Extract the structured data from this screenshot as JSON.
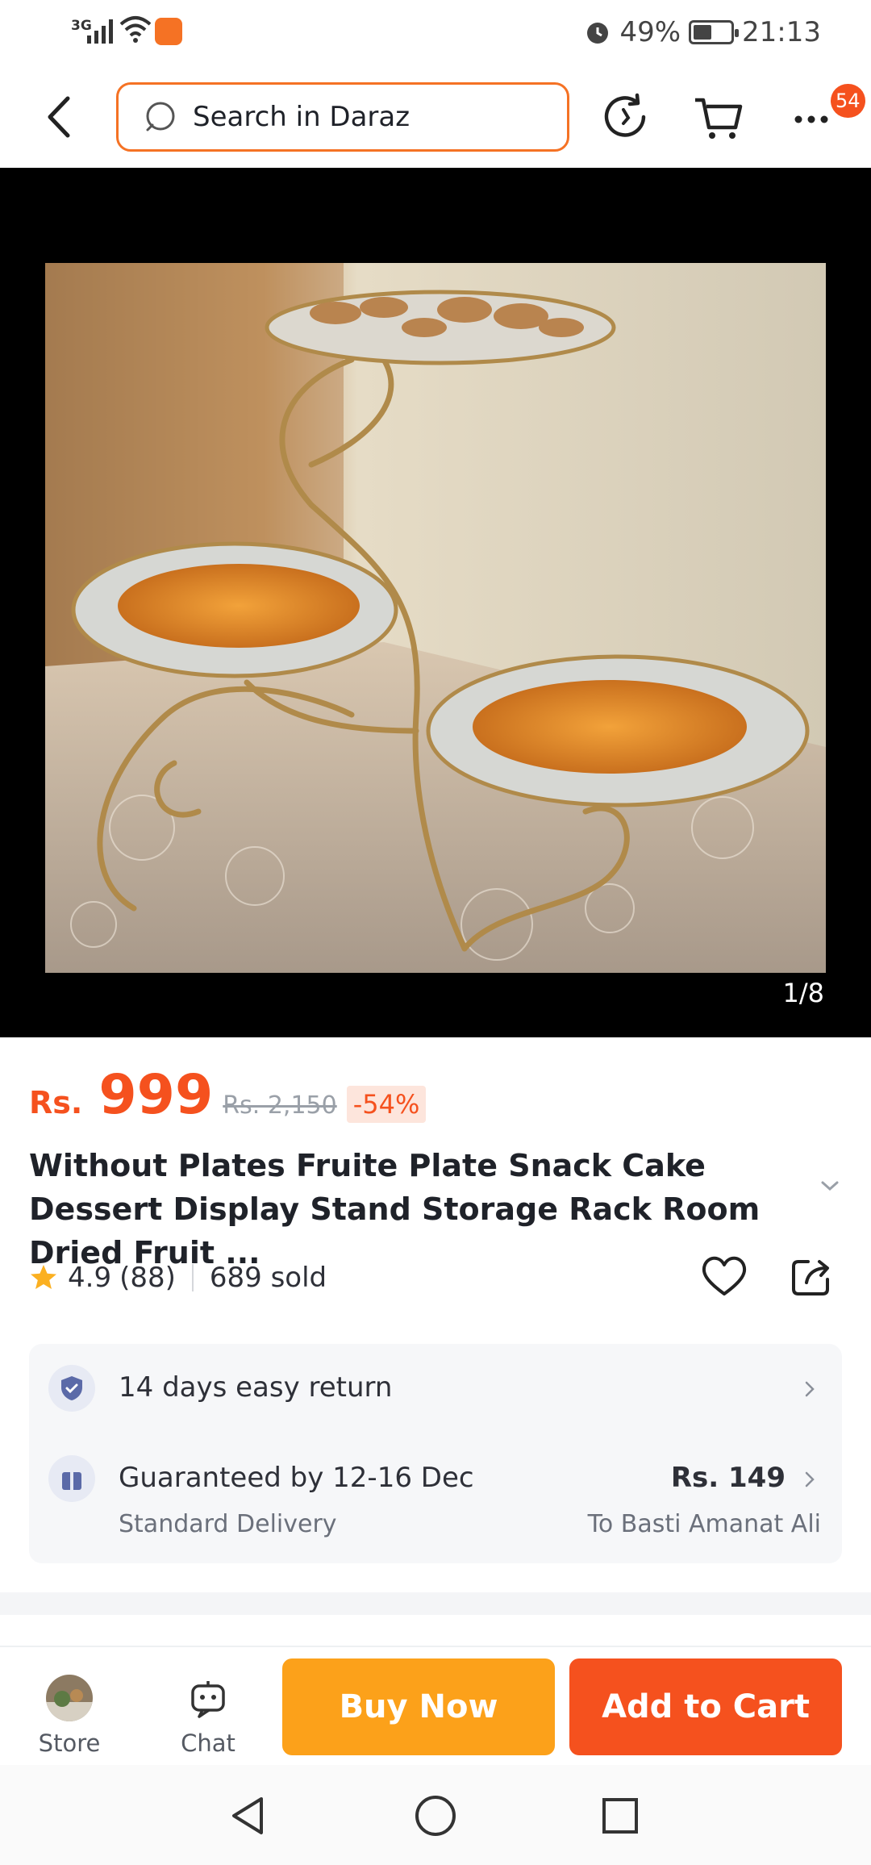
{
  "status_bar": {
    "network": "3G",
    "battery_percent": "49%",
    "battery_level": 0.49,
    "time": "21:13"
  },
  "header": {
    "search_placeholder": "Search in Daraz",
    "more_badge_count": "54"
  },
  "hero": {
    "image_counter": "1/8"
  },
  "product": {
    "currency": "Rs.",
    "price": "999",
    "original_price": "Rs. 2,150",
    "discount": "-54%",
    "title": "Without Plates Fruite Plate Snack Cake Dessert Display Stand Storage Rack Room Dried Fruit ...",
    "rating": "4.9",
    "reviews": "(88)",
    "sold": "689 sold"
  },
  "services": {
    "returns": "14 days easy return",
    "delivery_title": "Guaranteed by 12-16 Dec",
    "delivery_type": "Standard Delivery",
    "delivery_price": "Rs. 149",
    "delivery_location": "To Basti Amanat Ali"
  },
  "bottom_bar": {
    "store_label": "Store",
    "chat_label": "Chat",
    "buy_now_label": "Buy Now",
    "add_to_cart_label": "Add to Cart"
  },
  "colors": {
    "brand_orange": "#f57224",
    "price_red": "#f5511e",
    "buy_now": "#fca11a"
  }
}
